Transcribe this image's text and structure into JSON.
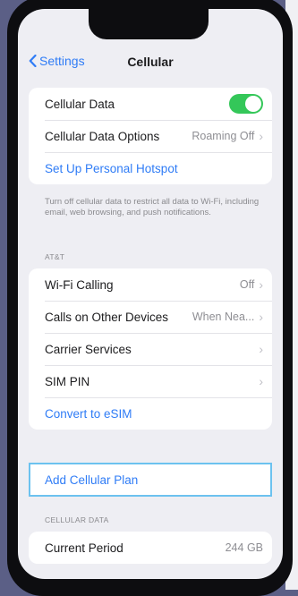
{
  "nav": {
    "back_label": "Settings",
    "title": "Cellular"
  },
  "group1": [
    {
      "label": "Cellular Data",
      "toggle": true
    },
    {
      "label": "Cellular Data Options",
      "value": "Roaming Off"
    },
    {
      "label": "Set Up Personal Hotspot",
      "link": true
    }
  ],
  "footnote": "Turn off cellular data to restrict all data to Wi-Fi, including email, web browsing, and push notifications.",
  "carrier_header": "AT&T",
  "group2": [
    {
      "label": "Wi-Fi Calling",
      "value": "Off"
    },
    {
      "label": "Calls on Other Devices",
      "value": "When Nea..."
    },
    {
      "label": "Carrier Services",
      "value": ""
    },
    {
      "label": "SIM PIN",
      "value": ""
    },
    {
      "label": "Convert to eSIM",
      "link": true
    }
  ],
  "add_plan_label": "Add Cellular Plan",
  "cellular_data_header": "CELLULAR DATA",
  "current_period": {
    "label": "Current Period",
    "value": "244 GB"
  },
  "colors": {
    "accent": "#2f7cf6",
    "toggle_on": "#34c759",
    "highlight": "#6cc2ef"
  }
}
